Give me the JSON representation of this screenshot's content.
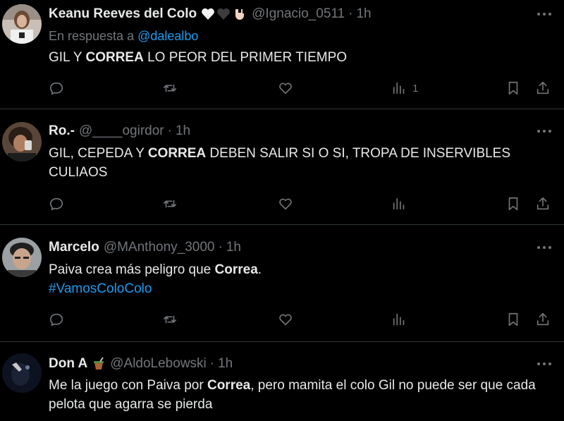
{
  "tweets": [
    {
      "name": "Keanu Reeves del Colo",
      "name_emojis": [
        "white-heart",
        "black-heart",
        "rock-hand"
      ],
      "handle": "@Ignacio_0511",
      "time": "1h",
      "reply_prefix": "En respuesta a",
      "reply_mention": "@dalealbo",
      "text_before": "GIL Y ",
      "text_bold": "CORREA",
      "text_after": " LO PEOR DEL PRIMER TIEMPO",
      "views": "1"
    },
    {
      "name": "Ro.-",
      "handle": "@____ogirdor",
      "time": "1h",
      "text_before": "GIL, CEPEDA Y ",
      "text_bold": "CORREA",
      "text_after": " DEBEN SALIR SI O SI, TROPA DE INSERVIBLES CULIAOS"
    },
    {
      "name": "Marcelo",
      "handle": "@MAnthony_3000",
      "time": "1h",
      "text_before": "Paiva crea más peligro que ",
      "text_bold": "Correa",
      "text_after": ".",
      "hashtag": "#VamosColoColo"
    },
    {
      "name": "Don A",
      "name_emojis": [
        "mate-cup"
      ],
      "handle": "@AldoLebowski",
      "time": "1h",
      "text_before": "Me la juego con Paiva por ",
      "text_bold": "Correa",
      "text_after": ", pero mamita el colo Gil no puede ser que cada pelota que agarra se pierda"
    }
  ],
  "separator": "·"
}
